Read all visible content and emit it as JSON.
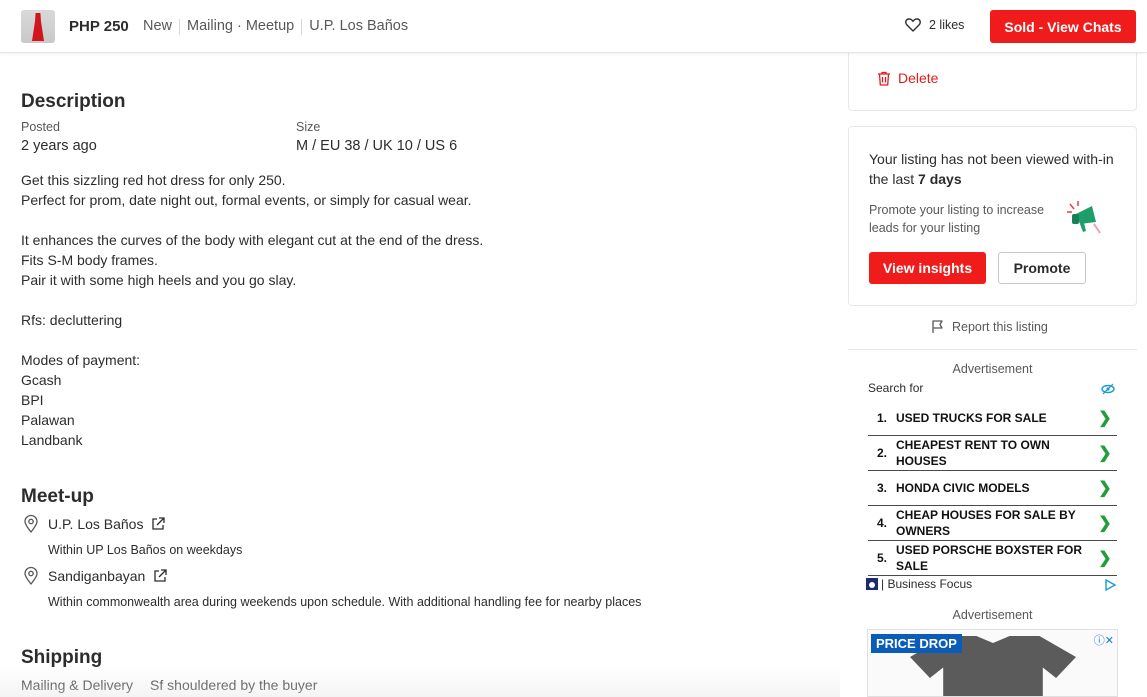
{
  "header": {
    "price": "PHP 250",
    "condition": "New",
    "delivery": "Mailing · Meetup",
    "location": "U.P. Los Baños",
    "likes": "2 likes",
    "sold_button": "Sold - View Chats"
  },
  "description": {
    "title": "Description",
    "posted_label": "Posted",
    "posted_value": "2 years ago",
    "size_label": "Size",
    "size_value": "M / EU 38 / UK 10 / US 6",
    "body": "Get this sizzling red hot dress for only 250.\nPerfect for prom, date night out, formal events, or simply for casual wear.\n\nIt enhances the curves of the body with elegant cut at the end of the dress.\nFits S-M body frames.\nPair it with some high heels and you go slay.\n\nRfs: decluttering\n\nModes of payment:\nGcash\nBPI\nPalawan\nLandbank"
  },
  "meetup": {
    "title": "Meet-up",
    "locations": [
      {
        "name": "U.P. Los Baños",
        "note": "Within UP Los Baños on weekdays"
      },
      {
        "name": "Sandiganbayan",
        "note": "Within commonwealth area during weekends upon schedule. With additional handling fee for nearby places"
      }
    ]
  },
  "shipping": {
    "title": "Shipping",
    "method": "Mailing & Delivery",
    "note": "Sf shouldered by the buyer"
  },
  "sidebar": {
    "delete_label": "Delete",
    "promo_text_prefix": "Your listing has not been viewed with-in the last ",
    "promo_days": "7 days",
    "promo_sub": "Promote your listing to increase leads for your listing",
    "insights_button": "View insights",
    "promote_button": "Promote",
    "report_label": "Report this listing"
  },
  "ads": {
    "label1": "Advertisement",
    "search_for": "Search for",
    "items": [
      {
        "num": "1.",
        "text": "USED TRUCKS FOR SALE"
      },
      {
        "num": "2.",
        "text": "CHEAPEST RENT TO OWN HOUSES"
      },
      {
        "num": "3.",
        "text": "HONDA CIVIC MODELS"
      },
      {
        "num": "4.",
        "text": "CHEAP HOUSES FOR SALE BY OWNERS"
      },
      {
        "num": "5.",
        "text": "USED PORSCHE BOXSTER FOR SALE"
      }
    ],
    "footer": "| Business Focus",
    "label2": "Advertisement",
    "price_drop": "PRICE DROP"
  },
  "colors": {
    "accent": "#f01b1b",
    "text": "#2c2c2c",
    "muted": "#57585a",
    "ad_chevron": "#1f9e3a"
  }
}
